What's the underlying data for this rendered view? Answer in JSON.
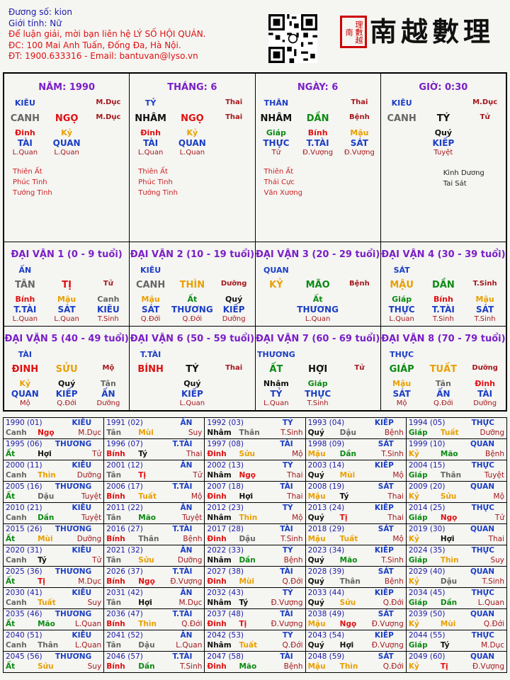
{
  "header": {
    "line1": "Đương số: kion",
    "line2": "Giới tính:   Nữ",
    "line3": "Để luận giải, mời bạn liên hệ LÝ SỐ HỘI QUÁN.",
    "line4": "ĐC: 100 Mai Anh Tuấn, Đống Đa, Hà Nội.",
    "line5": "ĐT: 1900.633316 - Email: bantuvan@lyso.vn",
    "seal_text": "理數越南",
    "logo_text": "南越數理"
  },
  "pillars": [
    {
      "title": "NĂM: 1990",
      "star_l": "KIÊU",
      "star_r": "M.Dục",
      "can": "CANH",
      "chi": "NGỌ",
      "chi_r": "M.Dục",
      "h1": "Đinh",
      "h2": "Kỷ",
      "s1": "TÀI",
      "s2": "QUAN",
      "q1": "L.Quan",
      "q2": "L.Quan",
      "notes": [
        "Thiên Ất",
        "Phúc Tinh",
        "Tướng Tinh"
      ]
    },
    {
      "title": "THÁNG: 6",
      "star_l": "TỶ",
      "star_r": "Thai",
      "can": "NHÂM",
      "chi": "NGỌ",
      "chi_r": "Thai",
      "h1": "Đinh",
      "h2": "Kỷ",
      "s1": "TÀI",
      "s2": "QUAN",
      "q1": "L.Quan",
      "q2": "L.Quan",
      "notes": [
        "Thiên Ất",
        "Phúc Tinh",
        "Tướng Tinh"
      ]
    },
    {
      "title": "NGÀY: 6",
      "star_l": "THÂN",
      "star_r": "Thai",
      "can": "NHÂM",
      "chi": "DẦN",
      "chi_r": "Bệnh",
      "h1": "Giáp",
      "h2": "Bính",
      "h3": "Mậu",
      "s1": "THỰC",
      "s2": "T.TÀI",
      "s3": "SÁT",
      "q1": "Tử",
      "q2": "Đ.Vượng",
      "q3": "Đ.Vượng",
      "notes": [
        "Thiên Ất",
        "Thái Cực",
        "Văn Xương"
      ]
    },
    {
      "title": "GIỜ: 0:30",
      "star_l": "KIÊU",
      "star_r": "M.Dục",
      "can": "CANH",
      "chi": "TÝ",
      "chi_r": "Tử",
      "h1": "Quý",
      "s1": "KIẾP",
      "q1": "Tuyệt",
      "notes": [
        "Kình Dương",
        "Tai Sát"
      ]
    }
  ],
  "dai_van": [
    {
      "title": "ĐẠI VẬN 1 (0 - 9 tuổi)",
      "star": "ẤN",
      "can": "TÂN",
      "chi": "TỊ",
      "chi_r": "Tử",
      "h": [
        "Bính",
        "Mậu",
        "Canh"
      ],
      "s": [
        "T.TÀI",
        "SÁT",
        "KIÊU"
      ],
      "q": [
        "L.Quan",
        "L.Quan",
        "T.Sinh"
      ]
    },
    {
      "title": "ĐẠI VẬN 2 (10 - 19 tuổi)",
      "star": "KIÊU",
      "can": "CANH",
      "chi": "THÌN",
      "chi_r": "Dưỡng",
      "h": [
        "Mậu",
        "Ất",
        "Quý"
      ],
      "s": [
        "SÁT",
        "THƯƠNG",
        "KIẾP"
      ],
      "q": [
        "Q.Đới",
        "Q.Đới",
        "Dưỡng"
      ]
    },
    {
      "title": "ĐẠI VẬN 3 (20 - 29 tuổi)",
      "star": "QUAN",
      "can": "KỶ",
      "chi": "MÃO",
      "chi_r": "Bệnh",
      "h": [
        "",
        "Ất",
        ""
      ],
      "s": [
        "",
        "THƯƠNG",
        ""
      ],
      "q": [
        "",
        "L.Quan",
        ""
      ]
    },
    {
      "title": "ĐẠI VẬN 4 (30 - 39 tuổi)",
      "star": "SÁT",
      "can": "MẬU",
      "chi": "DẦN",
      "chi_r": "T.Sinh",
      "h": [
        "Giáp",
        "Bính",
        "Mậu"
      ],
      "s": [
        "THỰC",
        "T.TÀI",
        "SÁT"
      ],
      "q": [
        "L.Quan",
        "T.Sinh",
        "T.Sinh"
      ]
    },
    {
      "title": "ĐẠI VẬN 5 (40 - 49 tuổi)",
      "star": "TÀI",
      "can": "ĐINH",
      "chi": "SỬU",
      "chi_r": "Mộ",
      "h": [
        "Kỷ",
        "Quý",
        "Tân"
      ],
      "s": [
        "QUAN",
        "KIẾP",
        "ẤN"
      ],
      "q": [
        "Mộ",
        "Q.Đới",
        "Dưỡng"
      ]
    },
    {
      "title": "ĐẠI VẬN 6 (50 - 59 tuổi)",
      "star": "T.TÀI",
      "can": "BÍNH",
      "chi": "TÝ",
      "chi_r": "Thai",
      "h": [
        "",
        "Quý",
        ""
      ],
      "s": [
        "",
        "KIẾP",
        ""
      ],
      "q": [
        "",
        "L.Quan",
        ""
      ]
    },
    {
      "title": "ĐẠI VẬN 7 (60 - 69 tuổi)",
      "star": "THƯƠNG",
      "can": "ẤT",
      "chi": "HỢI",
      "chi_r": "Tử",
      "h": [
        "Nhâm",
        "Giáp",
        ""
      ],
      "s": [
        "TỶ",
        "THỰC",
        ""
      ],
      "q": [
        "L.Quan",
        "T.Sinh",
        ""
      ]
    },
    {
      "title": "ĐẠI VẬN 8 (70 - 79 tuổi)",
      "star": "THỰC",
      "can": "GIÁP",
      "chi": "TUẤT",
      "chi_r": "Dưỡng",
      "h": [
        "Mậu",
        "Tân",
        "Đinh"
      ],
      "s": [
        "SÁT",
        "ẤN",
        "TÀI"
      ],
      "q": [
        "Mộ",
        "Q.Đới",
        "Dưỡng"
      ]
    }
  ],
  "years": [
    [
      [
        "1990 (01)",
        "KIÊU",
        "Canh",
        "Ngọ",
        "M.Dục"
      ],
      [
        "1991 (02)",
        "ẤN",
        "Tân",
        "Mùi",
        "Suy"
      ],
      [
        "1992 (03)",
        "TỶ",
        "Nhâm",
        "Thân",
        "T.Sinh"
      ],
      [
        "1993 (04)",
        "KIẾP",
        "Quý",
        "Dậu",
        "Bệnh"
      ],
      [
        "1994 (05)",
        "THỰC",
        "Giáp",
        "Tuất",
        "Dưỡng"
      ]
    ],
    [
      [
        "1995 (06)",
        "THƯƠNG",
        "Ất",
        "Hợi",
        "Tử"
      ],
      [
        "1996 (07)",
        "T.TÀI",
        "Bính",
        "Tý",
        "Thai"
      ],
      [
        "1997 (08)",
        "TÀI",
        "Đinh",
        "Sửu",
        "Mộ"
      ],
      [
        "1998 (09)",
        "SÁT",
        "Mậu",
        "Dần",
        "T.Sinh"
      ],
      [
        "1999 (10)",
        "QUAN",
        "Kỷ",
        "Mão",
        "Bệnh"
      ]
    ],
    [
      [
        "2000 (11)",
        "KIÊU",
        "Canh",
        "Thìn",
        "Dưỡng"
      ],
      [
        "2001 (12)",
        "ẤN",
        "Tân",
        "Tị",
        "Tử"
      ],
      [
        "2002 (13)",
        "TỶ",
        "Nhâm",
        "Ngọ",
        "Thai"
      ],
      [
        "2003 (14)",
        "KIẾP",
        "Quý",
        "Mùi",
        "Mộ"
      ],
      [
        "2004 (15)",
        "THỰC",
        "Giáp",
        "Thân",
        "Tuyệt"
      ]
    ],
    [
      [
        "2005 (16)",
        "THƯƠNG",
        "Ất",
        "Dậu",
        "Tuyệt"
      ],
      [
        "2006 (17)",
        "T.TÀI",
        "Bính",
        "Tuất",
        "Mộ"
      ],
      [
        "2007 (18)",
        "TÀI",
        "Đinh",
        "Hợi",
        "Thai"
      ],
      [
        "2008 (19)",
        "SÁT",
        "Mậu",
        "Tý",
        "Thai"
      ],
      [
        "2009 (20)",
        "QUAN",
        "Kỷ",
        "Sửu",
        "Mộ"
      ]
    ],
    [
      [
        "2010 (21)",
        "KIÊU",
        "Canh",
        "Dần",
        "Tuyệt"
      ],
      [
        "2011 (22)",
        "ẤN",
        "Tân",
        "Mão",
        "Tuyệt"
      ],
      [
        "2012 (23)",
        "TỶ",
        "Nhâm",
        "Thìn",
        "Mộ"
      ],
      [
        "2013 (24)",
        "KIẾP",
        "Quý",
        "Tị",
        "Thai"
      ],
      [
        "2014 (25)",
        "THỰC",
        "Giáp",
        "Ngọ",
        "Tử"
      ]
    ],
    [
      [
        "2015 (26)",
        "THƯƠNG",
        "Ất",
        "Mùi",
        "Dưỡng"
      ],
      [
        "2016 (27)",
        "T.TÀI",
        "Bính",
        "Thân",
        "Bệnh"
      ],
      [
        "2017 (28)",
        "TÀI",
        "Đinh",
        "Dậu",
        "T.Sinh"
      ],
      [
        "2018 (29)",
        "SÁT",
        "Mậu",
        "Tuất",
        "Mộ"
      ],
      [
        "2019 (30)",
        "QUAN",
        "Kỷ",
        "Hợi",
        "Thai"
      ]
    ],
    [
      [
        "2020 (31)",
        "KIÊU",
        "Canh",
        "Tý",
        "Tử"
      ],
      [
        "2021 (32)",
        "ẤN",
        "Tân",
        "Sửu",
        "Dưỡng"
      ],
      [
        "2022 (33)",
        "TỶ",
        "Nhâm",
        "Dần",
        "Bệnh"
      ],
      [
        "2023 (34)",
        "KIẾP",
        "Quý",
        "Mão",
        "T.Sinh"
      ],
      [
        "2024 (35)",
        "THỰC",
        "Giáp",
        "Thìn",
        "Suy"
      ]
    ],
    [
      [
        "2025 (36)",
        "THƯƠNG",
        "Ất",
        "Tị",
        "M.Dục"
      ],
      [
        "2026 (37)",
        "T.TÀI",
        "Bính",
        "Ngọ",
        "Đ.Vượng"
      ],
      [
        "2027 (38)",
        "TÀI",
        "Đinh",
        "Mùi",
        "Q.Đới"
      ],
      [
        "2028 (39)",
        "SÁT",
        "Quý",
        "Thân",
        "Bệnh"
      ],
      [
        "2029 (40)",
        "QUAN",
        "Kỷ",
        "Dậu",
        "T.Sinh"
      ]
    ],
    [
      [
        "2030 (41)",
        "KIÊU",
        "Canh",
        "Tuất",
        "Suy"
      ],
      [
        "2031 (42)",
        "ẤN",
        "Tân",
        "Hợi",
        "M.Dục"
      ],
      [
        "2032 (43)",
        "TỶ",
        "Nhâm",
        "Tý",
        "Đ.Vượng"
      ],
      [
        "2033 (44)",
        "KIẾP",
        "Quý",
        "Sửu",
        "Q.Đới"
      ],
      [
        "2034 (45)",
        "THỰC",
        "Giáp",
        "Dần",
        "L.Quan"
      ]
    ],
    [
      [
        "2035 (46)",
        "THƯƠNG",
        "Ất",
        "Mão",
        "L.Quan"
      ],
      [
        "2036 (47)",
        "T.TÀI",
        "Bính",
        "Thìn",
        "Q.Đới"
      ],
      [
        "2037 (48)",
        "TÀI",
        "Đinh",
        "Tị",
        "Đ.Vượng"
      ],
      [
        "2038 (49)",
        "SÁT",
        "Mậu",
        "Ngọ",
        "Đ.Vượng"
      ],
      [
        "2039 (50)",
        "QUAN",
        "Kỷ",
        "Mùi",
        "Q.Đới"
      ]
    ],
    [
      [
        "2040 (51)",
        "KIÊU",
        "Canh",
        "Thân",
        "L.Quan"
      ],
      [
        "2041 (52)",
        "ẤN",
        "Tân",
        "Dậu",
        "L.Quan"
      ],
      [
        "2042 (53)",
        "TỶ",
        "Nhâm",
        "Tuất",
        "Q.Đới"
      ],
      [
        "2043 (54)",
        "KIẾP",
        "Quý",
        "Hợi",
        "Đ.Vượng"
      ],
      [
        "2044 (55)",
        "THỰC",
        "Giáp",
        "Tý",
        "M.Dục"
      ]
    ],
    [
      [
        "2045 (56)",
        "THƯƠNG",
        "Ất",
        "Sửu",
        "Suy"
      ],
      [
        "2046 (57)",
        "T.TÀI",
        "Bính",
        "Dần",
        "T.Sinh"
      ],
      [
        "2047 (58)",
        "TÀI",
        "Đinh",
        "Mão",
        "Bệnh"
      ],
      [
        "2048 (59)",
        "SÁT",
        "Mậu",
        "Thìn",
        "Q.Đới"
      ],
      [
        "2049 (60)",
        "QUAN",
        "Kỷ",
        "Tị",
        "Đ.Vượng"
      ]
    ]
  ],
  "colors": {
    "title_purple": "#7a1fc7",
    "stem_colors": {
      "Canh": "#666666",
      "Tân": "#666666",
      "Nhâm": "#111111",
      "Quý": "#111111",
      "Giáp": "#0b8a12",
      "Ất": "#0b8a12",
      "Bính": "#e01010",
      "Đinh": "#e01010",
      "Mậu": "#e8a000",
      "Kỷ": "#e8a000"
    },
    "branch_colors": {
      "Thân": "#666666",
      "Dậu": "#666666",
      "Tý": "#111111",
      "Hợi": "#111111",
      "Dần": "#0b8a12",
      "Mão": "#0b8a12",
      "Tị": "#e01010",
      "Ngọ": "#e01010",
      "Thìn": "#e8a000",
      "Tuất": "#e8a000",
      "Sửu": "#e8a000",
      "Mùi": "#e8a000"
    }
  }
}
